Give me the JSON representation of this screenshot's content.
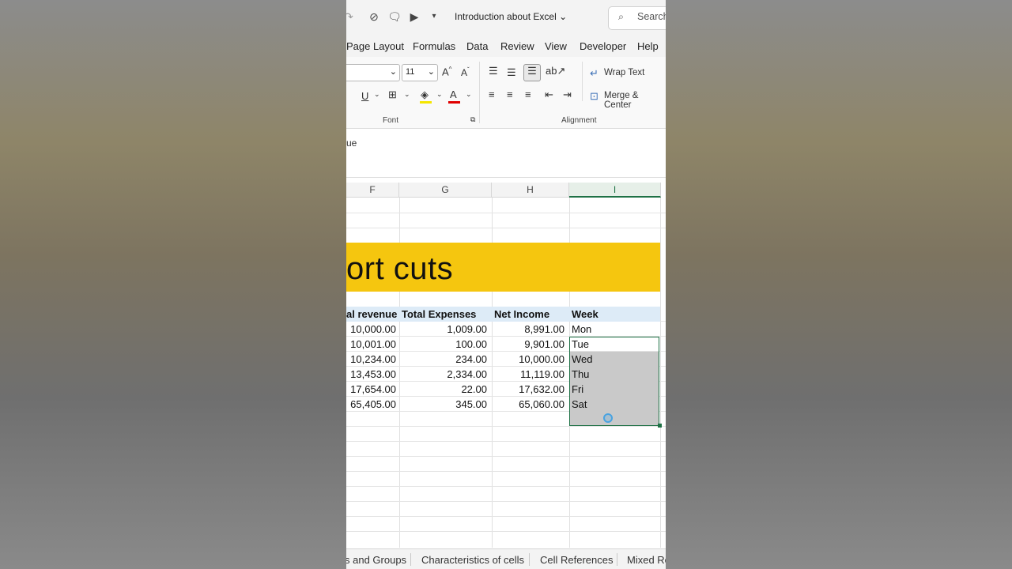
{
  "window": {
    "title": "Introduction about Excel",
    "search_placeholder": "Search"
  },
  "menu": [
    "Page Layout",
    "Formulas",
    "Data",
    "Review",
    "View",
    "Developer",
    "Help"
  ],
  "ribbon": {
    "font_size": "11",
    "wrap_text": "Wrap Text",
    "merge_center": "Merge & Center",
    "group_font": "Font",
    "group_alignment": "Alignment"
  },
  "formula_bar": {
    "content": "ue"
  },
  "columns": [
    "F",
    "G",
    "H",
    "I"
  ],
  "banner_text": "ort cuts",
  "table": {
    "headers": [
      "al revenue",
      "Total Expenses",
      "Net Income",
      "Week"
    ],
    "rows": [
      [
        "10,000.00",
        "1,009.00",
        "8,991.00",
        "Mon"
      ],
      [
        "10,001.00",
        "100.00",
        "9,901.00",
        "Tue"
      ],
      [
        "10,234.00",
        "234.00",
        "10,000.00",
        "Wed"
      ],
      [
        "13,453.00",
        "2,334.00",
        "11,119.00",
        "Thu"
      ],
      [
        "17,654.00",
        "22.00",
        "17,632.00",
        "Fri"
      ],
      [
        "65,405.00",
        "345.00",
        "65,060.00",
        "Sat"
      ]
    ]
  },
  "sheet_tabs": [
    "s and Groups",
    "Characteristics of cells",
    "Cell References",
    "Mixed Re"
  ],
  "colors": {
    "accent": "#1e7145",
    "banner": "#f5c60f",
    "header_row": "#ddebf7",
    "selection_fill": "#c9c9c9"
  }
}
